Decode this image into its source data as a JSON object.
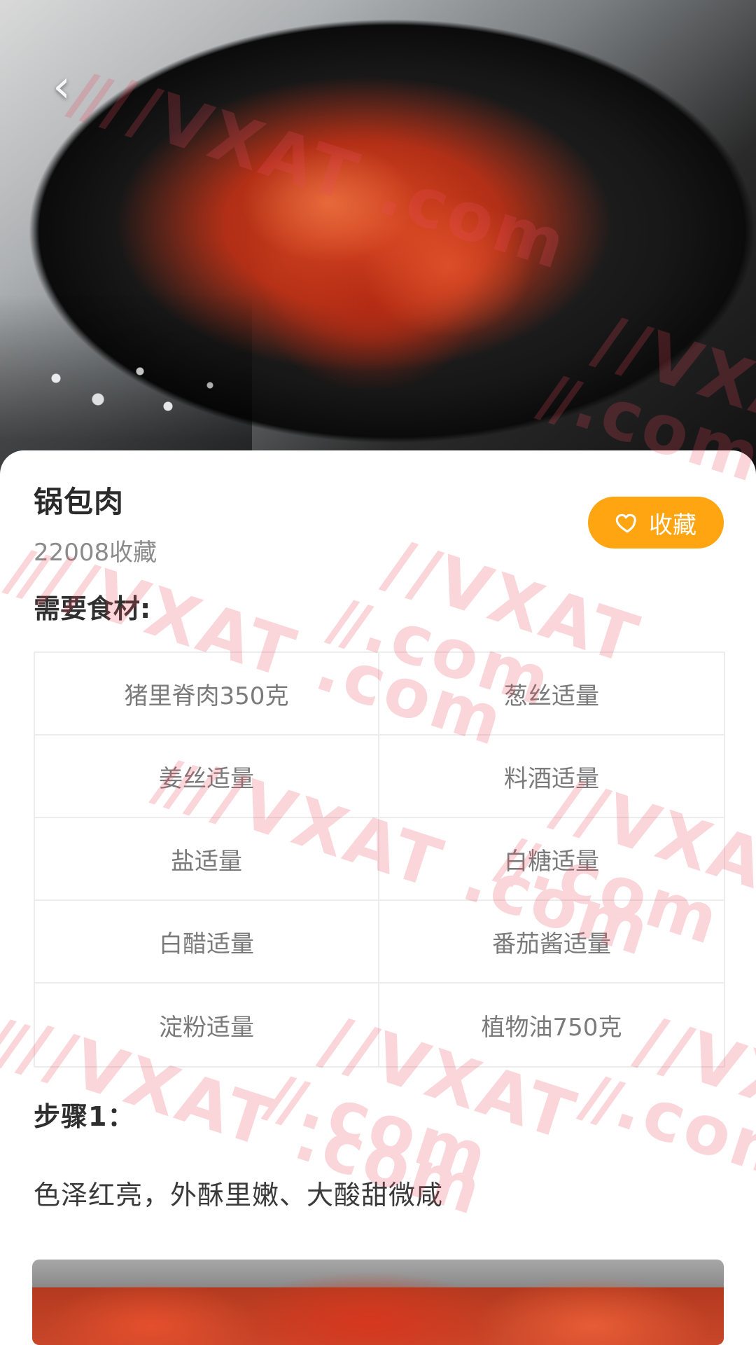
{
  "header": {
    "back_icon": "chevron-left-icon"
  },
  "recipe": {
    "title": "锅包肉",
    "favorites_count_text": "22008收藏",
    "favorite_button_label": "收藏",
    "favorite_icon": "heart-outline-icon",
    "ingredients_title": "需要食材:",
    "ingredients": [
      [
        "猪里脊肉350克",
        "葱丝适量"
      ],
      [
        "姜丝适量",
        "料酒适量"
      ],
      [
        "盐适量",
        "白糖适量"
      ],
      [
        "白醋适量",
        "番茄酱适量"
      ],
      [
        "淀粉适量",
        "植物油750克"
      ]
    ],
    "step_title": "步骤1：",
    "step_description": "色泽红亮，外酥里嫩、大酸甜微咸"
  },
  "colors": {
    "accent": "#ffa511",
    "text_primary": "#2b2b2b",
    "text_secondary": "#8b8b8b",
    "grid_border": "#ececec"
  },
  "watermarks": [
    "//VXAT .com",
    "//VXAT .com",
    "//VXAT .com",
    "//VXAT .com",
    "//VXAT .com",
    "//VXAT .com",
    "//VXAT .com",
    "//VXAT .com",
    "//VXAT .com"
  ]
}
